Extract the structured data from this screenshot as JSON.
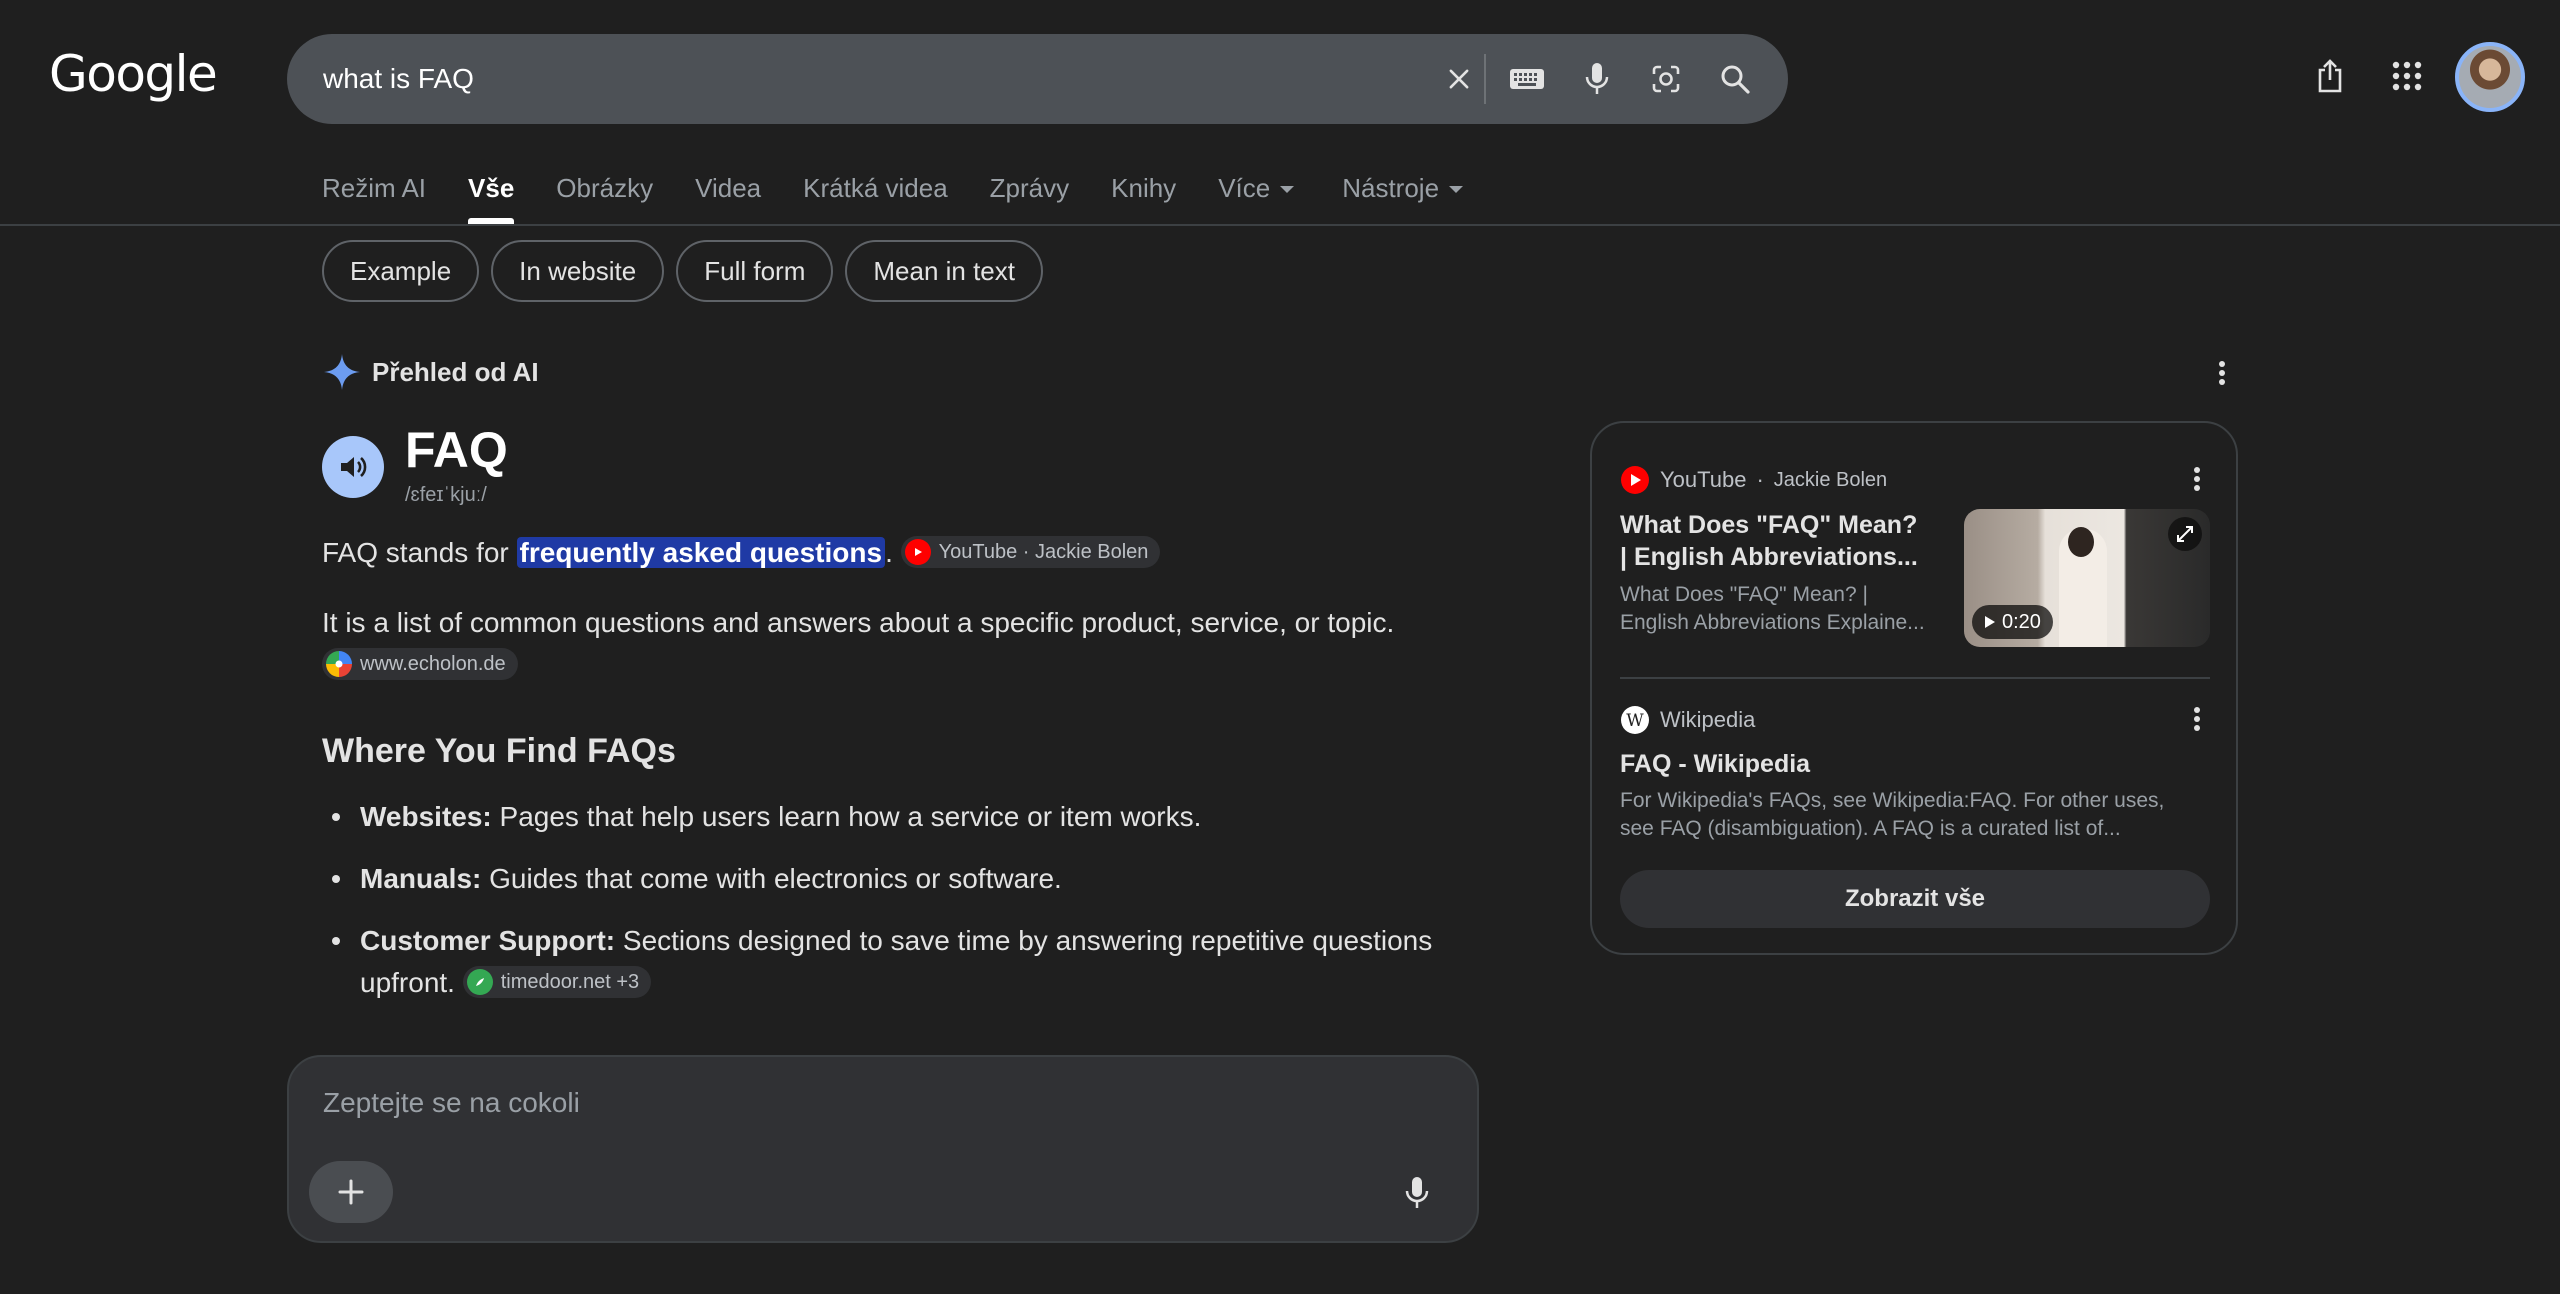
{
  "header": {
    "logo": "Google",
    "search": {
      "query": "what is FAQ"
    }
  },
  "tabs": [
    {
      "label": "Režim AI"
    },
    {
      "label": "Vše",
      "active": true
    },
    {
      "label": "Obrázky"
    },
    {
      "label": "Videa"
    },
    {
      "label": "Krátká videa"
    },
    {
      "label": "Zprávy"
    },
    {
      "label": "Knihy"
    },
    {
      "label": "Více"
    },
    {
      "label": "Nástroje"
    }
  ],
  "chips": [
    "Example",
    "In website",
    "Full form",
    "Mean in text"
  ],
  "ai_overview": {
    "header": "Přehled od AI",
    "word": "FAQ",
    "pronunciation": "/ɛfeɪˈkjuː/",
    "p1": {
      "before": "FAQ stands for ",
      "highlight": "frequently asked questions",
      "after": ".",
      "source": "YouTube · Jackie Bolen"
    },
    "p2": {
      "text": "It is a list of common questions and answers about a specific product, service, or topic.",
      "source": "www.echolon.de"
    },
    "section_title": "Where You Find FAQs",
    "bullets": [
      {
        "term": "Websites:",
        "text": " Pages that help users learn how a service or item works."
      },
      {
        "term": "Manuals:",
        "text": " Guides that come with electronics or software."
      },
      {
        "term": "Customer Support:",
        "text": " Sections designed to save time by answering repetitive questions upfront.",
        "source": "timedoor.net +3"
      }
    ]
  },
  "ask": {
    "placeholder": "Zeptejte se na cokoli"
  },
  "panel": {
    "card1": {
      "source": "YouTube",
      "author": "Jackie Bolen",
      "title": "What Does \"FAQ\" Mean? | English Abbreviations...",
      "snippet": "What Does \"FAQ\" Mean? | English Abbreviations Explaine...",
      "duration": "0:20"
    },
    "card2": {
      "source": "Wikipedia",
      "title": "FAQ - Wikipedia",
      "snippet": "For Wikipedia's FAQs, see Wikipedia:FAQ. For other uses, see FAQ (disambiguation). A FAQ is a curated list of..."
    },
    "show_all": "Zobrazit vše"
  },
  "colors": {
    "background": "#1f1f1f",
    "highlight": "#1f3aa5",
    "accent": "#8ab4f8",
    "youtube": "#ff0000"
  }
}
